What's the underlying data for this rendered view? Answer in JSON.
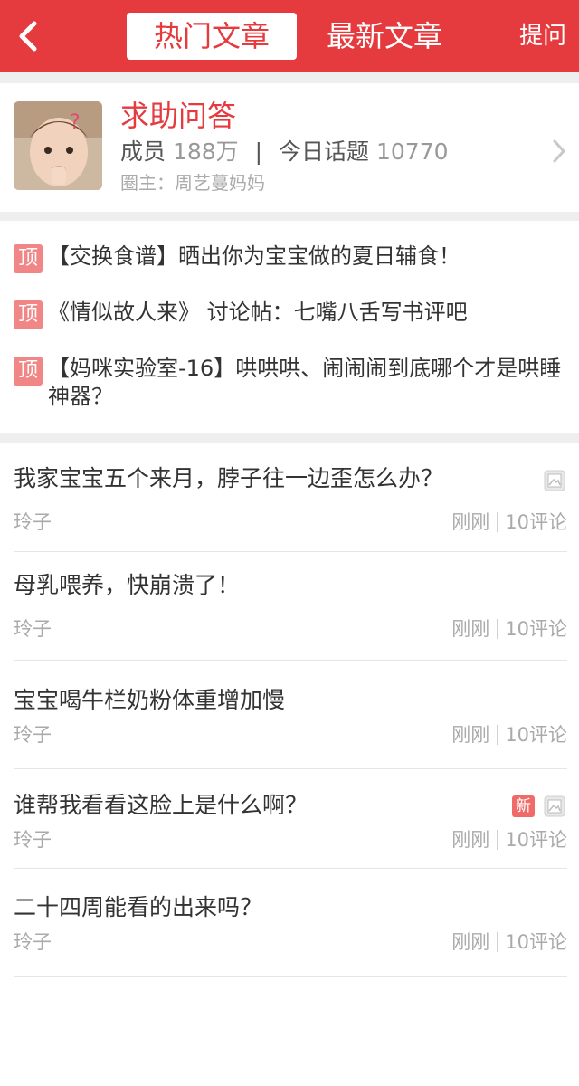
{
  "header": {
    "back_icon": "chevron-left-icon",
    "tabs": [
      {
        "label": "热门文章",
        "active": true
      },
      {
        "label": "最新文章",
        "active": false
      }
    ],
    "ask_label": "提问",
    "bar_color": "#e53a3e"
  },
  "group": {
    "name": "求助问答",
    "members_label": "成员",
    "members_value": "188万",
    "separator": "|",
    "topics_label": "今日话题",
    "topics_value": "10770",
    "owner_text": "圈主：周艺蔓妈妈",
    "arrow_icon": "chevron-right-icon",
    "avatar": "avatar-image"
  },
  "pinned": {
    "badge_label": "顶",
    "items": [
      {
        "text": "【交换食谱】晒出你为宝宝做的夏日辅食！"
      },
      {
        "text": "《情似故人来》 讨论帖：七嘴八舌写书评吧"
      },
      {
        "text": "【妈咪实验室-16】哄哄哄、闹闹闹到底哪个才是哄睡神器？"
      }
    ]
  },
  "posts": [
    {
      "title": "我家宝宝五个来月，脖子往一边歪怎么办？",
      "author": "玲子",
      "time": "刚刚",
      "comments": "10评论",
      "has_image": true,
      "is_new": false
    },
    {
      "title": "母乳喂养，快崩溃了！",
      "author": "玲子",
      "time": "刚刚",
      "comments": "10评论",
      "has_image": false,
      "is_new": false
    },
    {
      "title": "宝宝喝牛栏奶粉体重增加慢",
      "author": "玲子",
      "time": "刚刚",
      "comments": "10评论",
      "has_image": false,
      "is_new": false
    },
    {
      "title": "谁帮我看看这脸上是什么啊？",
      "author": "玲子",
      "time": "刚刚",
      "comments": "10评论",
      "has_image": true,
      "is_new": true,
      "new_label": "新"
    },
    {
      "title": "二十四周能看的出来吗？",
      "author": "玲子",
      "time": "刚刚",
      "comments": "10评论",
      "has_image": false,
      "is_new": false
    }
  ]
}
